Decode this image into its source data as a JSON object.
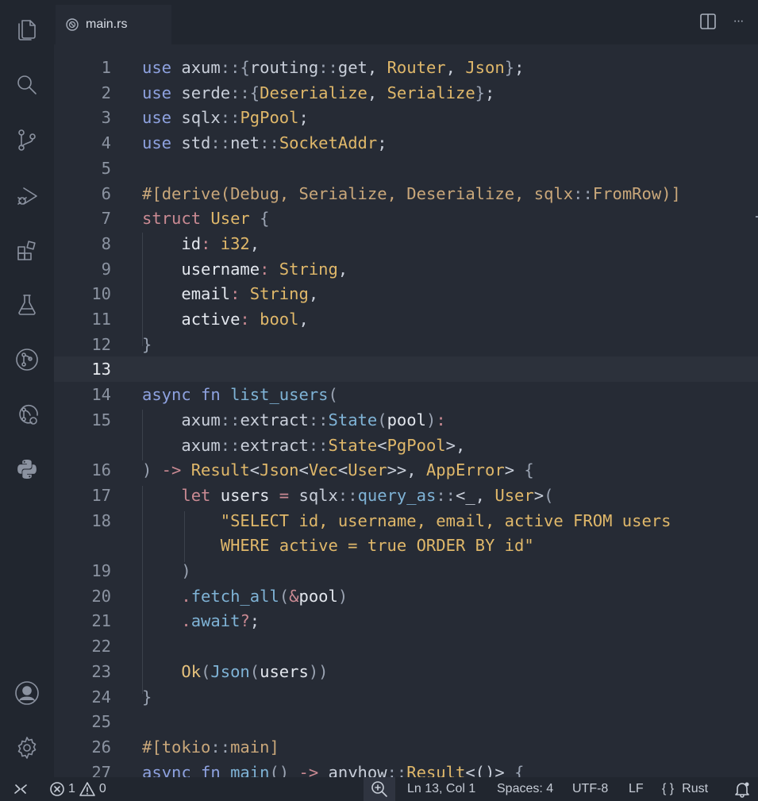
{
  "tab": {
    "filename": "main.rs",
    "file_icon": "rust-icon"
  },
  "tab_actions": {
    "split_icon": "split-editor-icon",
    "more_label": "···"
  },
  "activity_bar": [
    {
      "name": "explorer-icon"
    },
    {
      "name": "search-icon"
    },
    {
      "name": "source-control-icon"
    },
    {
      "name": "run-debug-icon"
    },
    {
      "name": "extensions-icon"
    },
    {
      "name": "testing-icon"
    },
    {
      "name": "git-graph-icon"
    },
    {
      "name": "pull-requests-icon"
    },
    {
      "name": "python-icon"
    },
    {
      "name": "account-icon"
    },
    {
      "name": "settings-gear-icon"
    }
  ],
  "editor": {
    "current_line": 13,
    "lines": [
      {
        "n": "1",
        "tokens": [
          [
            "use",
            "k"
          ],
          [
            " axum",
            "n"
          ],
          [
            "::",
            "o"
          ],
          [
            "{",
            "br"
          ],
          [
            "routing",
            "n"
          ],
          [
            "::",
            "o"
          ],
          [
            "get",
            "n"
          ],
          [
            ", ",
            "n"
          ],
          [
            "Router",
            "p"
          ],
          [
            ", ",
            "n"
          ],
          [
            "Json",
            "p"
          ],
          [
            "}",
            "br"
          ],
          [
            ";",
            "n"
          ]
        ]
      },
      {
        "n": "2",
        "tokens": [
          [
            "use",
            "k"
          ],
          [
            " serde",
            "n"
          ],
          [
            "::",
            "o"
          ],
          [
            "{",
            "br"
          ],
          [
            "Deserialize",
            "p"
          ],
          [
            ", ",
            "n"
          ],
          [
            "Serialize",
            "p"
          ],
          [
            "}",
            "br"
          ],
          [
            ";",
            "n"
          ]
        ]
      },
      {
        "n": "3",
        "tokens": [
          [
            "use",
            "k"
          ],
          [
            " sqlx",
            "n"
          ],
          [
            "::",
            "o"
          ],
          [
            "PgPool",
            "p"
          ],
          [
            ";",
            "n"
          ]
        ]
      },
      {
        "n": "4",
        "tokens": [
          [
            "use",
            "k"
          ],
          [
            " std",
            "n"
          ],
          [
            "::",
            "o"
          ],
          [
            "net",
            "n"
          ],
          [
            "::",
            "o"
          ],
          [
            "SocketAddr",
            "p"
          ],
          [
            ";",
            "n"
          ]
        ]
      },
      {
        "n": "5",
        "tokens": []
      },
      {
        "n": "6",
        "tokens": [
          [
            "#[",
            "a"
          ],
          [
            "derive",
            "a"
          ],
          [
            "(",
            "a"
          ],
          [
            "Debug",
            "a"
          ],
          [
            ", ",
            "a"
          ],
          [
            "Serialize",
            "a"
          ],
          [
            ", ",
            "a"
          ],
          [
            "Deserialize",
            "a"
          ],
          [
            ", ",
            "a"
          ],
          [
            "sqlx",
            "a"
          ],
          [
            "::",
            "o"
          ],
          [
            "FromRow",
            "a"
          ],
          [
            ")]",
            "a"
          ]
        ]
      },
      {
        "n": "7",
        "tokens": [
          [
            "struct",
            "m"
          ],
          [
            " ",
            "n"
          ],
          [
            "User",
            "p"
          ],
          [
            " {",
            "br"
          ]
        ]
      },
      {
        "n": "8",
        "tokens": [
          [
            "    id",
            "v"
          ],
          [
            ": ",
            "m"
          ],
          [
            "i32",
            "p"
          ],
          [
            ",",
            "n"
          ]
        ]
      },
      {
        "n": "9",
        "tokens": [
          [
            "    username",
            "v"
          ],
          [
            ": ",
            "m"
          ],
          [
            "String",
            "p"
          ],
          [
            ",",
            "n"
          ]
        ]
      },
      {
        "n": "10",
        "tokens": [
          [
            "    email",
            "v"
          ],
          [
            ": ",
            "m"
          ],
          [
            "String",
            "p"
          ],
          [
            ",",
            "n"
          ]
        ]
      },
      {
        "n": "11",
        "tokens": [
          [
            "    active",
            "v"
          ],
          [
            ": ",
            "m"
          ],
          [
            "bool",
            "p"
          ],
          [
            ",",
            "n"
          ]
        ]
      },
      {
        "n": "12",
        "tokens": [
          [
            "}",
            "br"
          ]
        ]
      },
      {
        "n": "13",
        "tokens": []
      },
      {
        "n": "14",
        "tokens": [
          [
            "async",
            "k"
          ],
          [
            " fn ",
            "k"
          ],
          [
            "list_users",
            "f"
          ],
          [
            "(",
            "br"
          ]
        ]
      },
      {
        "n": "15",
        "tokens": [
          [
            "    axum",
            "n"
          ],
          [
            "::",
            "o"
          ],
          [
            "extract",
            "n"
          ],
          [
            "::",
            "o"
          ],
          [
            "State",
            "f"
          ],
          [
            "(",
            "br"
          ],
          [
            "pool",
            "v"
          ],
          [
            ")",
            "br"
          ],
          [
            ":",
            "m"
          ]
        ]
      },
      {
        "n": "",
        "tokens": [
          [
            "    axum",
            "n"
          ],
          [
            "::",
            "o"
          ],
          [
            "extract",
            "n"
          ],
          [
            "::",
            "o"
          ],
          [
            "State",
            "p"
          ],
          [
            "<",
            "n"
          ],
          [
            "PgPool",
            "p"
          ],
          [
            ">,",
            "n"
          ]
        ]
      },
      {
        "n": "16",
        "tokens": [
          [
            ")",
            "br"
          ],
          [
            " -> ",
            "m"
          ],
          [
            "Result",
            "p"
          ],
          [
            "<",
            "n"
          ],
          [
            "Json",
            "p"
          ],
          [
            "<",
            "n"
          ],
          [
            "Vec",
            "p"
          ],
          [
            "<",
            "n"
          ],
          [
            "User",
            "p"
          ],
          [
            ">>, ",
            "n"
          ],
          [
            "AppError",
            "p"
          ],
          [
            "> ",
            "n"
          ],
          [
            "{",
            "br"
          ]
        ]
      },
      {
        "n": "17",
        "tokens": [
          [
            "    let",
            "m"
          ],
          [
            " users",
            "v"
          ],
          [
            " = ",
            "m"
          ],
          [
            "sqlx",
            "n"
          ],
          [
            "::",
            "o"
          ],
          [
            "query_as",
            "f"
          ],
          [
            "::",
            "o"
          ],
          [
            "<_, ",
            "n"
          ],
          [
            "User",
            "p"
          ],
          [
            ">",
            "n"
          ],
          [
            "(",
            "br"
          ]
        ]
      },
      {
        "n": "18",
        "tokens": [
          [
            "        \"SELECT id, username, email, active FROM users",
            "s"
          ]
        ]
      },
      {
        "n": "",
        "tokens": [
          [
            "        WHERE active = true ORDER BY id\"",
            "s"
          ]
        ]
      },
      {
        "n": "19",
        "tokens": [
          [
            "    )",
            "br"
          ]
        ]
      },
      {
        "n": "20",
        "tokens": [
          [
            "    .",
            "m"
          ],
          [
            "fetch_all",
            "f"
          ],
          [
            "(",
            "br"
          ],
          [
            "&",
            "m"
          ],
          [
            "pool",
            "v"
          ],
          [
            ")",
            "br"
          ]
        ]
      },
      {
        "n": "21",
        "tokens": [
          [
            "    .",
            "m"
          ],
          [
            "await",
            "f"
          ],
          [
            "?",
            "m"
          ],
          [
            ";",
            "n"
          ]
        ]
      },
      {
        "n": "22",
        "tokens": []
      },
      {
        "n": "23",
        "tokens": [
          [
            "    Ok",
            "b"
          ],
          [
            "(",
            "br"
          ],
          [
            "Json",
            "f"
          ],
          [
            "(",
            "br"
          ],
          [
            "users",
            "v"
          ],
          [
            "))",
            "br"
          ]
        ]
      },
      {
        "n": "24",
        "tokens": [
          [
            "}",
            "br"
          ]
        ]
      },
      {
        "n": "25",
        "tokens": []
      },
      {
        "n": "26",
        "tokens": [
          [
            "#[",
            "a"
          ],
          [
            "tokio",
            "a"
          ],
          [
            "::",
            "o"
          ],
          [
            "main",
            "a"
          ],
          [
            "]",
            "a"
          ]
        ]
      },
      {
        "n": "27",
        "tokens": [
          [
            "async",
            "k"
          ],
          [
            " fn ",
            "k"
          ],
          [
            "main",
            "f"
          ],
          [
            "() ",
            "br"
          ],
          [
            "-> ",
            "m"
          ],
          [
            "anyhow",
            "n"
          ],
          [
            "::",
            "o"
          ],
          [
            "Result",
            "p"
          ],
          [
            "<()> ",
            "n"
          ],
          [
            "{",
            "br"
          ]
        ]
      }
    ]
  },
  "statusbar": {
    "remote_icon": "remote-icon",
    "errors": "1",
    "warnings": "0",
    "zoom_icon": "zoom-icon",
    "cursor": "Ln 13, Col 1",
    "indent": "Spaces: 4",
    "encoding": "UTF-8",
    "eol": "LF",
    "language_braces": "{ }",
    "language": "Rust",
    "notifications_icon": "bell-icon"
  }
}
